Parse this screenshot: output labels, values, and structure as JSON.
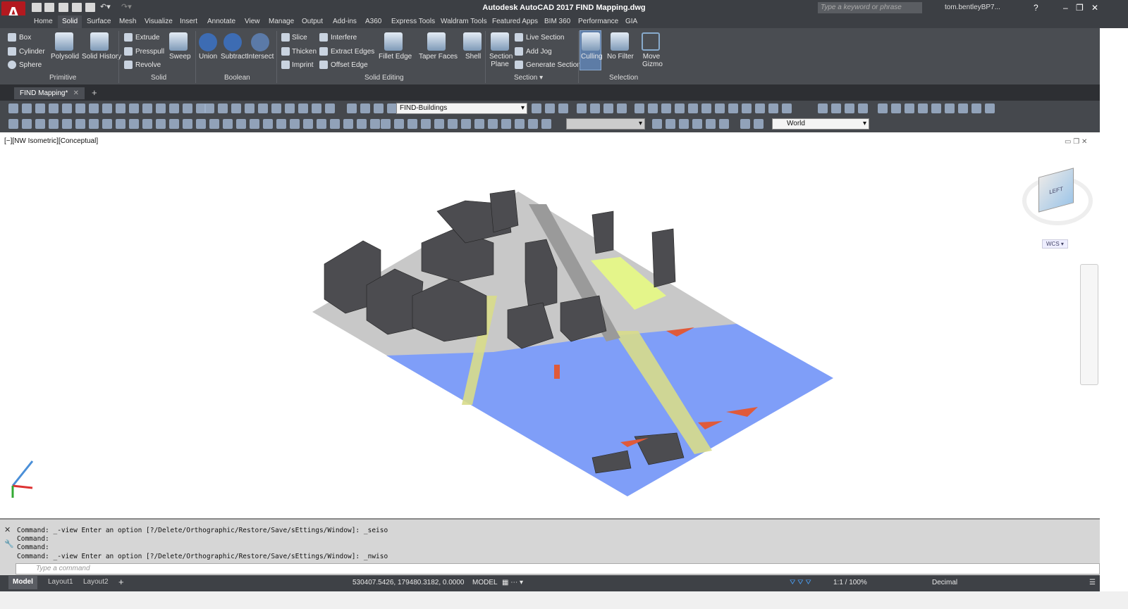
{
  "app": {
    "title": "Autodesk AutoCAD 2017   FIND Mapping.dwg",
    "search_placeholder": "Type a keyword or phrase",
    "user": "tom.bentleyBP7..."
  },
  "tabs": [
    "Home",
    "Solid",
    "Surface",
    "Mesh",
    "Visualize",
    "Insert",
    "Annotate",
    "View",
    "Manage",
    "Output",
    "Add-ins",
    "A360",
    "Express Tools",
    "Waldram Tools",
    "Featured Apps",
    "BIM 360",
    "Performance",
    "GIA"
  ],
  "active_tab": "Solid",
  "ribbon": {
    "primitive": {
      "label": "Primitive",
      "items": [
        "Box",
        "Cylinder",
        "Sphere"
      ],
      "polysolid": "Polysolid",
      "solid_history": "Solid History"
    },
    "solid": {
      "label": "Solid",
      "items": [
        "Extrude",
        "Presspull",
        "Revolve"
      ],
      "sweep": "Sweep"
    },
    "boolean": {
      "label": "Boolean",
      "items": [
        "Union",
        "Subtract",
        "Intersect"
      ]
    },
    "solid_editing": {
      "label": "Solid Editing",
      "items": [
        "Slice",
        "Thicken",
        "Imprint",
        "Interfere",
        "Extract Edges",
        "Offset Edge"
      ],
      "fillet": "Fillet Edge",
      "taper": "Taper Faces",
      "shell": "Shell"
    },
    "section": {
      "label": "Section",
      "plane": "Section Plane",
      "items": [
        "Live Section",
        "Add Jog",
        "Generate Section"
      ]
    },
    "selection": {
      "label": "Selection",
      "culling": "Culling",
      "nofilter": "No Filter",
      "gizmo": "Move Gizmo"
    }
  },
  "doc_tab": "FIND Mapping*",
  "toolbar": {
    "layer": "FIND-Buildings",
    "ucs": "World"
  },
  "viewport": {
    "label": "[−][NW Isometric][Conceptual]",
    "wcs": "WCS",
    "cube_face": "LEFT"
  },
  "command": {
    "lines": [
      "Command: _-view Enter an option [?/Delete/Orthographic/Restore/Save/sEttings/Window]: _seiso",
      "Command:",
      "Command:",
      "Command: _-view Enter an option [?/Delete/Orthographic/Restore/Save/sEttings/Window]: _nwiso"
    ],
    "placeholder": "Type a command"
  },
  "status": {
    "layouts": [
      "Model",
      "Layout1",
      "Layout2"
    ],
    "coords": "530407.5426, 179480.3182, 0.0000",
    "space": "MODEL",
    "scale": "1:1 / 100%",
    "units": "Decimal"
  },
  "colors": {
    "water": "#7f9ef8",
    "ground": "#c8c8c8",
    "buildings": "#4c4c50",
    "roads": "#d8dc8a",
    "accent": "#e05a3a"
  }
}
